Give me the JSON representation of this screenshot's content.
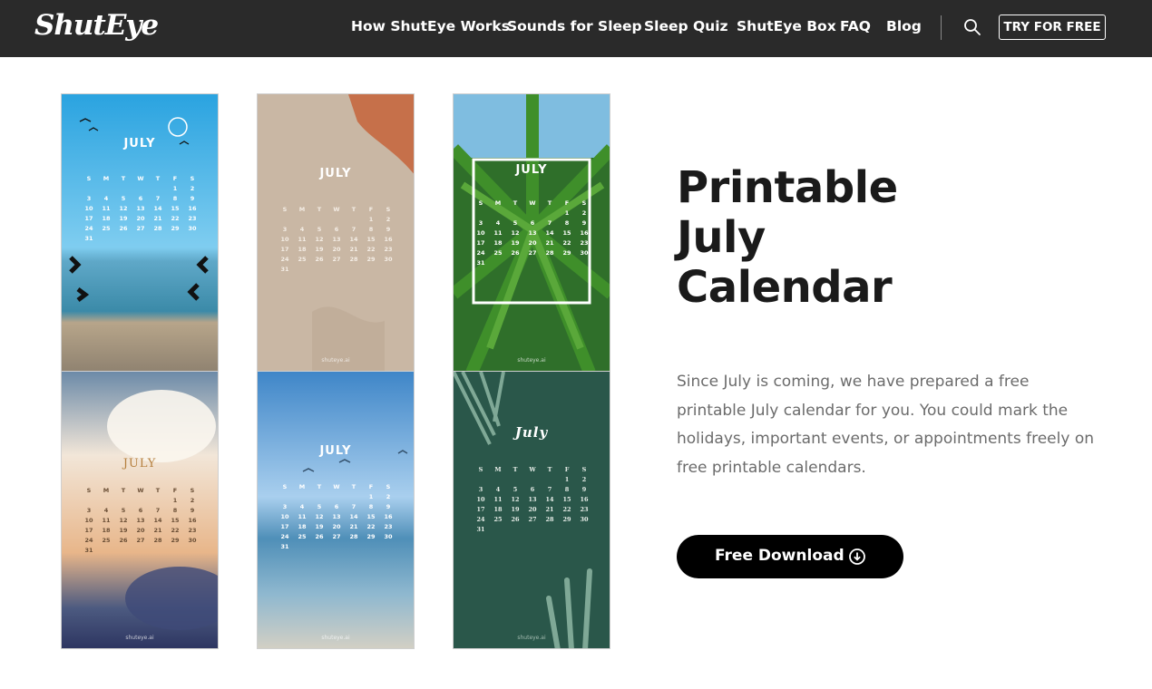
{
  "header": {
    "logo": "ShutEye",
    "nav": [
      "How ShutEye Works",
      "Sounds for Sleep",
      "Sleep Quiz",
      "ShutEye Box",
      "FAQ",
      "Blog"
    ],
    "try_label": "TRY FOR FREE"
  },
  "calendars": [
    {
      "title": "JULY",
      "weekdays": [
        "S",
        "M",
        "T",
        "W",
        "T",
        "F",
        "S"
      ],
      "watermark": ""
    },
    {
      "title": "JULY",
      "weekdays": [
        "S",
        "M",
        "T",
        "W",
        "T",
        "F",
        "S"
      ],
      "watermark": "shuteye.ai"
    },
    {
      "title": "JULY",
      "weekdays": [
        "S",
        "M",
        "T",
        "W",
        "T",
        "F",
        "S"
      ],
      "watermark": "shuteye.ai"
    },
    {
      "title": "JULY",
      "weekdays": [
        "S",
        "M",
        "T",
        "W",
        "T",
        "F",
        "S"
      ],
      "watermark": "shuteye.ai"
    },
    {
      "title": "JULY",
      "weekdays": [
        "S",
        "M",
        "T",
        "W",
        "T",
        "F",
        "S"
      ],
      "watermark": "shuteye.ai"
    },
    {
      "title": "July",
      "weekdays": [
        "S",
        "M",
        "T",
        "W",
        "T",
        "F",
        "S"
      ],
      "watermark": "shuteye.ai"
    }
  ],
  "calendar_weeks": [
    [
      "",
      "",
      "",
      "",
      "",
      "1",
      "2"
    ],
    [
      "3",
      "4",
      "5",
      "6",
      "7",
      "8",
      "9"
    ],
    [
      "10",
      "11",
      "12",
      "13",
      "14",
      "15",
      "16"
    ],
    [
      "17",
      "18",
      "19",
      "20",
      "21",
      "22",
      "23"
    ],
    [
      "24",
      "25",
      "26",
      "27",
      "28",
      "29",
      "30"
    ],
    [
      "31",
      "",
      "",
      "",
      "",
      "",
      ""
    ]
  ],
  "hero": {
    "title_lines": [
      "Printable",
      "July",
      "Calendar"
    ],
    "description": "Since July is coming, we have prepared a free printable July calendar for you. You could mark the holidays, important events, or appointments freely on free printable calendars.",
    "download_label": "Free Download"
  },
  "icons": {
    "search": "search-icon",
    "download": "download-circle-icon"
  }
}
